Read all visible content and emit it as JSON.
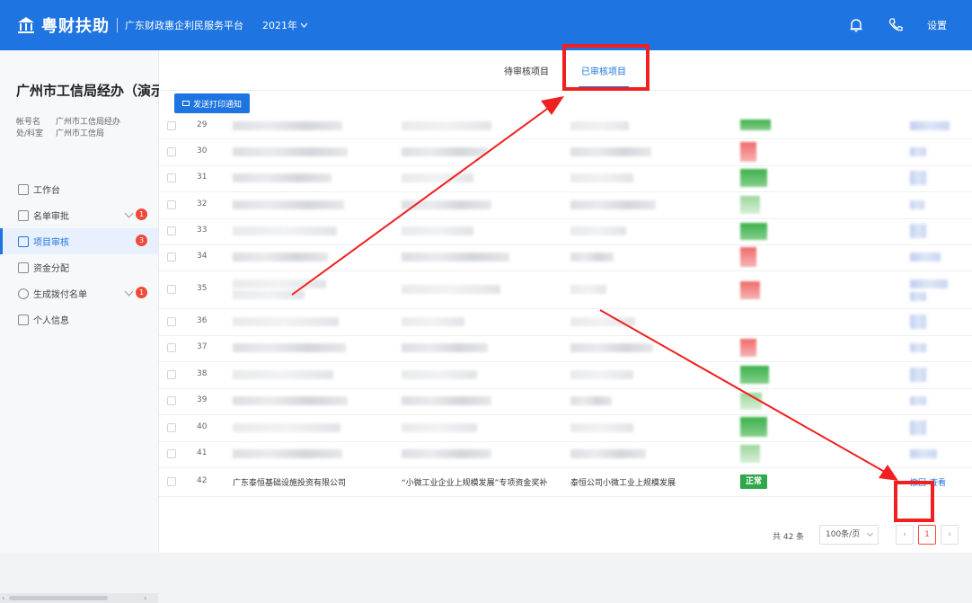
{
  "topbar": {
    "brand": "粤财扶助",
    "platform": "广东财政惠企利民服务平台",
    "year": "2021年",
    "settings": "设置"
  },
  "sidebar": {
    "org_name": "广州市工信局经办（演示）",
    "account_label": "帐号名",
    "account_value": "广州市工信局经办",
    "dept_label": "处/科室",
    "dept_value": "广州市工信局",
    "items": [
      {
        "label": "工作台"
      },
      {
        "label": "名单审批",
        "badge": "1"
      },
      {
        "label": "项目审核",
        "badge": "3"
      },
      {
        "label": "资金分配"
      },
      {
        "label": "生成拨付名单",
        "badge": "1"
      },
      {
        "label": "个人信息"
      }
    ]
  },
  "tabs": {
    "pending": "待审核项目",
    "reviewed": "已审核项目"
  },
  "notify_button": "发送打印通知",
  "table": {
    "rows": [
      {
        "num": "29"
      },
      {
        "num": "30"
      },
      {
        "num": "31"
      },
      {
        "num": "32"
      },
      {
        "num": "33"
      },
      {
        "num": "34"
      },
      {
        "num": "35"
      },
      {
        "num": "36"
      },
      {
        "num": "37"
      },
      {
        "num": "38"
      },
      {
        "num": "39"
      },
      {
        "num": "40"
      },
      {
        "num": "41"
      }
    ],
    "last_row": {
      "num": "42",
      "company": "广东泰恒基础设施投资有限公司",
      "project": "“小微工业企业上规模发展”专项资金奖补",
      "declarant": "泰恒公司小微工业上规模发展",
      "status": "正常",
      "action_withdraw": "撤回",
      "action_view": "查看"
    }
  },
  "pager": {
    "total": "共 42 条",
    "page_size": "100条/页",
    "current": "1"
  },
  "colors": {
    "primary": "#1e74e0",
    "annotation_red": "#f02020",
    "status_green": "#2ea84a"
  }
}
